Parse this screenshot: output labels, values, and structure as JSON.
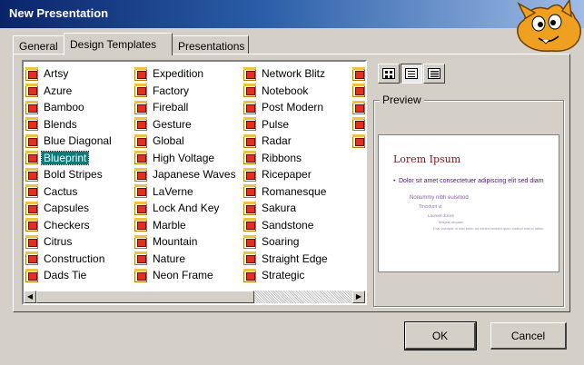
{
  "window": {
    "title": "New Presentation"
  },
  "tabs": [
    {
      "label": "General"
    },
    {
      "label": "Design Templates"
    },
    {
      "label": "Presentations"
    }
  ],
  "templates": {
    "columns": [
      [
        "Artsy",
        "Azure",
        "Bamboo",
        "Blends",
        "Blue Diagonal",
        "Blueprint",
        "Bold Stripes",
        "Cactus",
        "Capsules",
        "Checkers",
        "Citrus",
        "Construction",
        "Dads Tie"
      ],
      [
        "Expedition",
        "Factory",
        "Fireball",
        "Gesture",
        "Global",
        "High Voltage",
        "Japanese Waves",
        "LaVerne",
        "Lock And Key",
        "Marble",
        "Mountain",
        "Nature",
        "Neon Frame"
      ],
      [
        "Network Blitz",
        "Notebook",
        "Post Modern",
        "Pulse",
        "Radar",
        "Ribbons",
        "Ricepaper",
        "Romanesque",
        "Sakura",
        "Sandstone",
        "Soaring",
        "Straight Edge",
        "Strategic"
      ]
    ],
    "selected": "Blueprint"
  },
  "preview": {
    "label": "Preview",
    "slide_title": "Lorem Ipsum",
    "bullet1": "Dolor sit amet consectetuer adipiscing elit sed diam",
    "bullet2": "Nonummy nibh euismod",
    "bullet3": "Tincidunt ut",
    "bullet4": "Laoreet dolore",
    "bullet5": "Magna aliquam",
    "bullet6": "Erat volutpat ut wisi enim ad minim veniam quis nostrud exerci tation"
  },
  "buttons": {
    "ok": "OK",
    "cancel": "Cancel"
  }
}
